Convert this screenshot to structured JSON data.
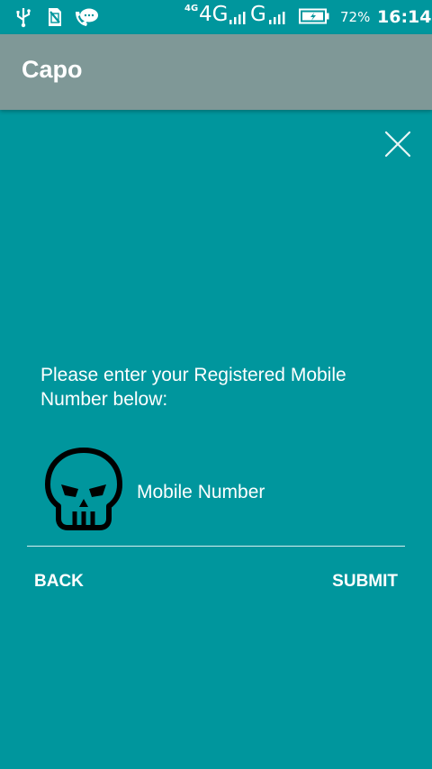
{
  "status_bar": {
    "network_small": "4G",
    "network_large": "4G",
    "network_g": "G",
    "battery_percent": "72%",
    "time": "16:14",
    "icons": [
      "usb-icon",
      "no-sim-icon",
      "chat-icon",
      "signal-icon",
      "battery-charging-icon"
    ]
  },
  "app_bar": {
    "title": "Capo"
  },
  "dialog": {
    "close_icon": "close-icon",
    "prompt": "Please enter your Registered Mobile Number below:",
    "avatar_icon": "skull-icon",
    "mobile_input": {
      "placeholder": "Mobile Number",
      "value": ""
    },
    "back_label": "BACK",
    "submit_label": "SUBMIT"
  },
  "colors": {
    "background": "#00969d",
    "app_bar": "#7f9897",
    "text": "#ffffff"
  }
}
